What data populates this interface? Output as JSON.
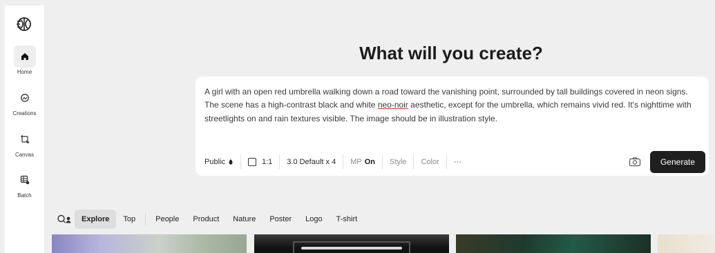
{
  "sidebar": {
    "items": [
      {
        "label": "Home",
        "icon": "home-icon",
        "active": true
      },
      {
        "label": "Creations",
        "icon": "creations-icon",
        "active": false
      },
      {
        "label": "Canvas",
        "icon": "canvas-icon",
        "active": false
      },
      {
        "label": "Batch",
        "icon": "batch-icon",
        "active": false
      }
    ]
  },
  "main": {
    "headline": "What will you create?",
    "prompt": {
      "text_before": "A girl with an open red umbrella walking down a road toward the vanishing point, surrounded by tall buildings covered in neon signs. The scene has a high-contrast black and white ",
      "underlined": "neo-noir",
      "text_after": " aesthetic, except for the umbrella, which remains vivid red. It's nighttime with streetlights on and rain textures visible. The image should be in illustration style."
    },
    "toolbar": {
      "visibility": "Public",
      "aspect": "1:1",
      "model": "3.0 Default x 4",
      "mp_label": "MP",
      "mp_value": "On",
      "style": "Style",
      "color": "Color",
      "more": "···",
      "generate": "Generate"
    },
    "filters": [
      "Explore",
      "Top",
      "People",
      "Product",
      "Nature",
      "Poster",
      "Logo",
      "T-shirt"
    ],
    "active_filter": "Explore"
  },
  "colors": {
    "background": "#efefef",
    "card": "#ffffff",
    "primary_button": "#1f1f1f",
    "active_chip": "#dedede"
  }
}
